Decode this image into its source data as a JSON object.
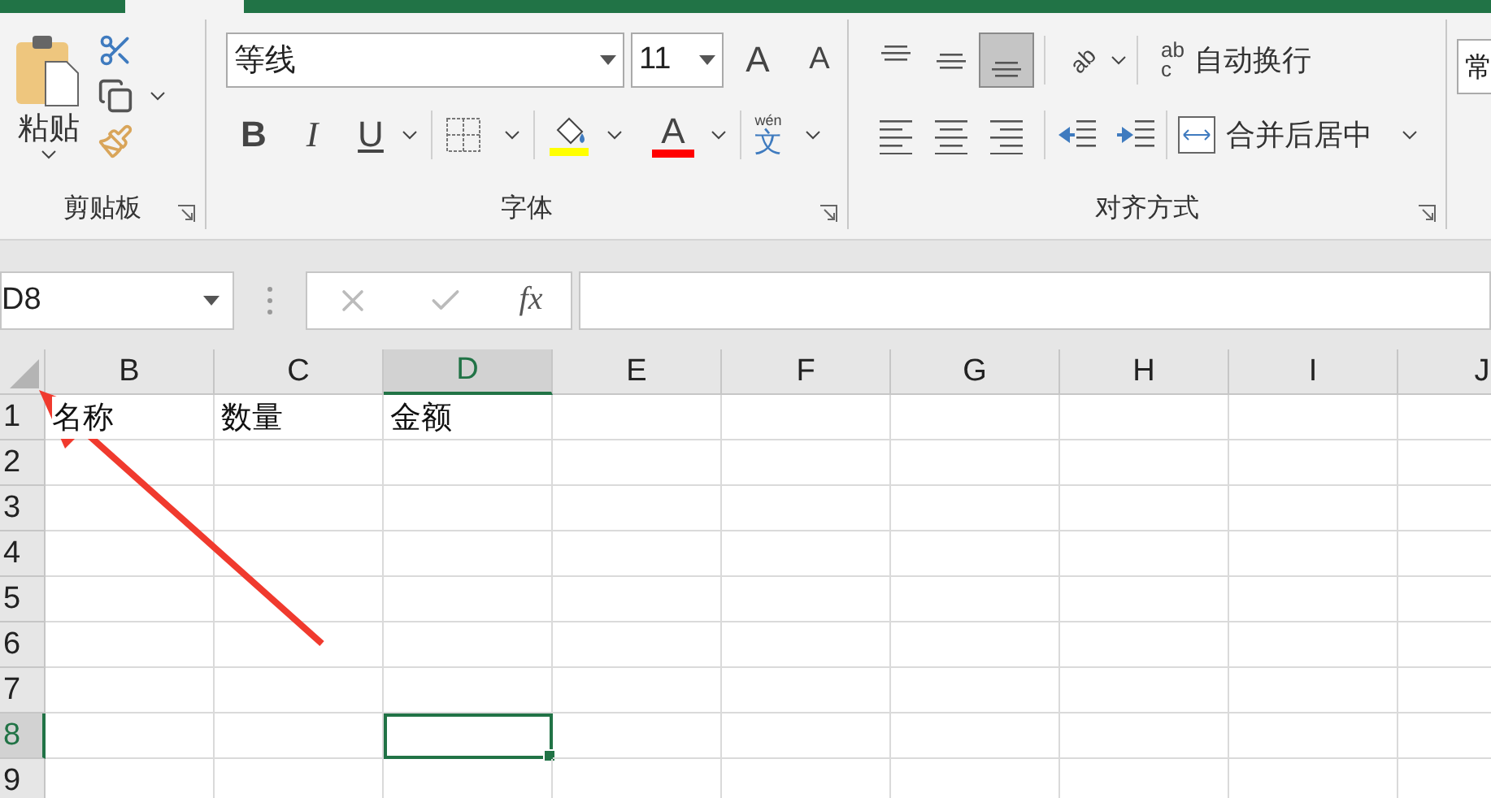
{
  "clipboard": {
    "paste": "粘贴",
    "label": "剪贴板"
  },
  "font": {
    "name": "等线",
    "size": "11",
    "grow": "A",
    "shrink": "A",
    "bold": "B",
    "italic": "I",
    "underline": "U",
    "font_color": "A",
    "pinyin": "wén",
    "pinyin_char": "文",
    "label": "字体"
  },
  "alignment": {
    "vertical": [
      {
        "selected": false
      },
      {
        "selected": false
      },
      {
        "selected": true
      }
    ],
    "orientation_glyph": "ab",
    "wrap_glyph": [
      "ab",
      "c"
    ],
    "wrap": "自动换行",
    "merge": "合并后居中",
    "label": "对齐方式"
  },
  "number": {
    "format": "常"
  },
  "formula_bar": {
    "name_box": "D8",
    "fx": "fx"
  },
  "grid": {
    "columns": [
      {
        "label": "B",
        "selected": false
      },
      {
        "label": "C",
        "selected": false
      },
      {
        "label": "D",
        "selected": true
      },
      {
        "label": "E",
        "selected": false
      },
      {
        "label": "F",
        "selected": false
      },
      {
        "label": "G",
        "selected": false
      },
      {
        "label": "H",
        "selected": false
      },
      {
        "label": "I",
        "selected": false
      },
      {
        "label": "J",
        "selected": false
      }
    ],
    "rows": [
      {
        "label": "1",
        "selected": false,
        "cells": [
          "名称",
          "数量",
          "金额"
        ]
      },
      {
        "label": "2",
        "selected": false,
        "cells": []
      },
      {
        "label": "3",
        "selected": false,
        "cells": []
      },
      {
        "label": "4",
        "selected": false,
        "cells": []
      },
      {
        "label": "5",
        "selected": false,
        "cells": []
      },
      {
        "label": "6",
        "selected": false,
        "cells": []
      },
      {
        "label": "7",
        "selected": false,
        "cells": []
      },
      {
        "label": "8",
        "selected": true,
        "cells": []
      },
      {
        "label": "9",
        "selected": false,
        "cells": []
      }
    ]
  }
}
